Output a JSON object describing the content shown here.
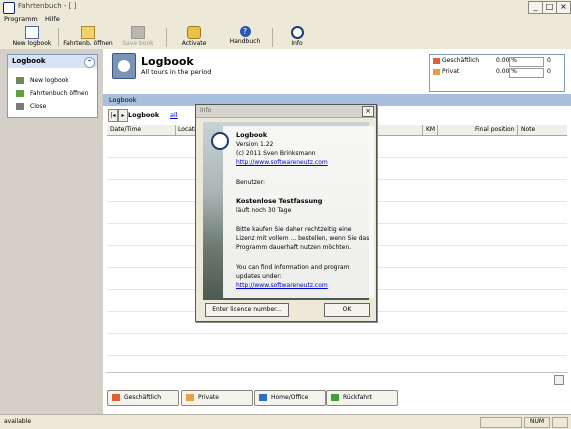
{
  "window": {
    "title": "Fahrtenbuch - [ ]",
    "min": "_",
    "max": "□",
    "close": "×"
  },
  "menu": {
    "items": [
      "Programm",
      "Hilfe"
    ]
  },
  "toolbar": {
    "buttons": [
      {
        "label": "New logbook",
        "icon": "new-logbook-icon",
        "enabled": true
      },
      {
        "label": "Fahrtenb. öffnen",
        "icon": "folder-open-icon",
        "enabled": true
      },
      {
        "label": "Save book",
        "icon": "save-icon",
        "enabled": false
      },
      {
        "label": "Activate",
        "icon": "key-icon",
        "enabled": true
      },
      {
        "label": "Handbuch",
        "icon": "help-icon",
        "enabled": true
      },
      {
        "label": "Info",
        "icon": "info-icon",
        "enabled": true
      }
    ]
  },
  "left_panel": {
    "title": "Logbook",
    "collapse": "⌃",
    "items": [
      {
        "label": "New logbook",
        "icon": "new-logbook-icon"
      },
      {
        "label": "Fahrtenbuch öffnen",
        "icon": "folder-open-icon"
      },
      {
        "label": "Close",
        "icon": "close-book-icon"
      }
    ]
  },
  "header": {
    "title": "Logbook",
    "subtitle": "All tours in the period"
  },
  "stats": [
    {
      "label": "Geschäftlich",
      "value": "0.00 %",
      "count": "0",
      "color": "#e06030"
    },
    {
      "label": "Privat",
      "value": "0.00 %",
      "count": "0",
      "color": "#e8a040"
    }
  ],
  "bluebar": {
    "label": "Logbook"
  },
  "tabs": {
    "nav_prev": "|◂",
    "nav_next": "▸",
    "active": "Logbook",
    "link": "all"
  },
  "table": {
    "columns": [
      "Date/Time",
      "Locati",
      "KM",
      "Final position",
      "Note"
    ]
  },
  "categories": [
    {
      "label": "Geschäftlich",
      "color": "#e06030"
    },
    {
      "label": "Private",
      "color": "#e8a040"
    },
    {
      "label": "Home/Office",
      "color": "#3070c0"
    },
    {
      "label": "Rückfahrt",
      "color": "#40a040"
    }
  ],
  "status": {
    "left": "available",
    "num": "NUM"
  },
  "dialog": {
    "title": "Info",
    "close": "×",
    "app_name": "Logbook",
    "version": "Version 1.22",
    "copyright": "(c) 2011 Sven Brinksmann",
    "url1": "http://www.softwareneutz.com",
    "user_label": "Benutzer:",
    "trial_title": "Kostenlose Testfassung",
    "trial_days": "läuft noch 30 Tage",
    "text1": "Bitte kaufen Sie daher rechtzeitig eine",
    "text2": "Lizenz mit vollem ... bestellen, wenn Sie das",
    "text3": "Programm dauerhaft nutzen möchten.",
    "text4": "You can find information and program",
    "text5": "updates under:",
    "url2": "http://www.softwareneutz.com",
    "licence_btn": "Enter licence number...",
    "ok_btn": "OK"
  }
}
